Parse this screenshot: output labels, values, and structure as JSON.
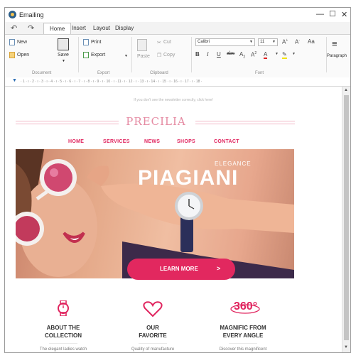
{
  "window": {
    "title": "Emailing",
    "min_glyph": "—",
    "max_glyph": "☐",
    "close_glyph": "✕"
  },
  "tabs": [
    {
      "label": "Home"
    },
    {
      "label": "Insert"
    },
    {
      "label": "Layout"
    },
    {
      "label": "Display"
    }
  ],
  "quick_access": {
    "undo_glyph": "↶",
    "redo_glyph": "↷"
  },
  "ribbon": {
    "document": {
      "new_label": "New",
      "open_label": "Open",
      "save_label": "Save",
      "group_label": "Document"
    },
    "export": {
      "print_label": "Print",
      "export_label": "Export",
      "group_label": "Export"
    },
    "clipboard": {
      "paste_label": "Paste",
      "cut_label": "Cut",
      "copy_label": "Copy",
      "group_label": "Clipboard"
    },
    "font": {
      "family": "Calibri",
      "size": "11",
      "group_label": "Font"
    },
    "paragraph": {
      "label": "Paragraph"
    }
  },
  "ruler": {
    "marks": "· 1 · ı · 2 · ı · 3 · ı · 4 · ı · 5 · ı · 6 · ı · 7 · ı · 8 · ı · 9 · ı · 10 · ı · 11 · ı · 12 · ı · 13 · ı · 14 · ı · 15 · ı · 16 · ı · 17 · ı · 18 ·"
  },
  "email": {
    "hint": "If you don't see the newsletter correctly, click here!",
    "brand": "PRECILIA",
    "nav": [
      "HOME",
      "SERVICES",
      "NEWS",
      "SHOPS",
      "CONTACT"
    ],
    "hero": {
      "tagline": "ELEGANCE",
      "title": "PIAGIANI",
      "cta_label": "LEARN MORE",
      "cta_arrow": ">"
    },
    "features": [
      {
        "icon": "watch-icon",
        "title_line1": "ABOUT THE",
        "title_line2": "COLLECTION",
        "desc": "The elegant ladies watch"
      },
      {
        "icon": "heart-icon",
        "title_line1": "OUR",
        "title_line2": "FAVORITE",
        "desc": "Quality of manufacture"
      },
      {
        "icon": "360-icon",
        "badge": "360°",
        "title_line1": "MAGNIFIC FROM",
        "title_line2": "EVERY ANGLE",
        "desc": "Discover this magnificent"
      }
    ]
  },
  "colors": {
    "accent": "#e0245e",
    "brand": "#e58aa2"
  }
}
